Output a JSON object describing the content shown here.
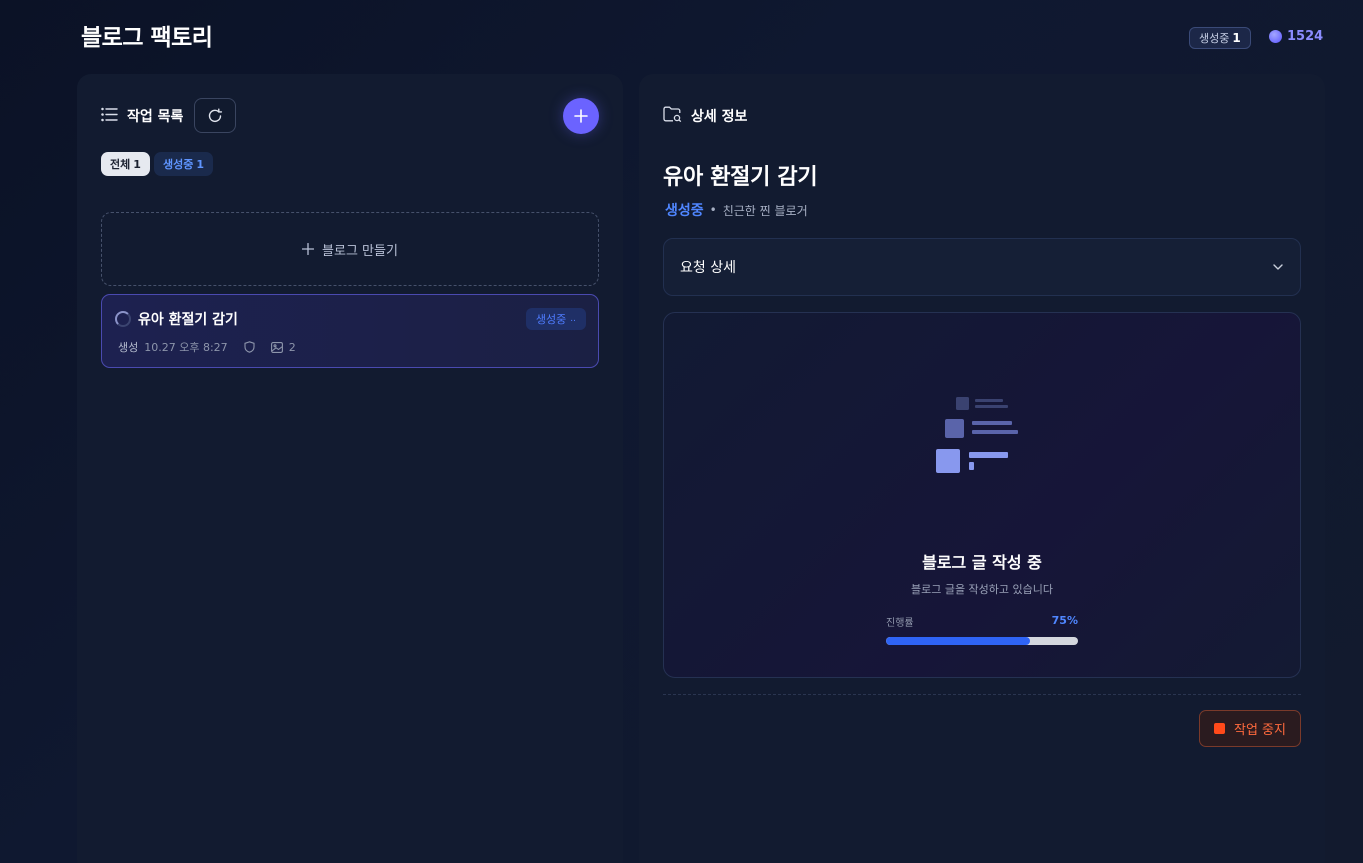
{
  "app": {
    "title": "블로그 팩토리"
  },
  "header": {
    "generating_badge": {
      "label": "생성중",
      "count": "1"
    },
    "credits": "1524"
  },
  "left_panel": {
    "title": "작업 목록",
    "filters": [
      {
        "label": "전체",
        "count": "1"
      },
      {
        "label": "생성중",
        "count": "1"
      }
    ],
    "create_label": "블로그 만들기",
    "jobs": [
      {
        "title": "유아 환절기 감기",
        "status": "생성중",
        "created_label": "생성",
        "created_at": "10.27 오후 8:27",
        "image_count": "2"
      }
    ]
  },
  "right_panel": {
    "title": "상세 정보",
    "job_title": "유아 환절기 감기",
    "status": "생성중",
    "persona": "친근한 찐 블로거",
    "request_detail_label": "요청 상세",
    "progress": {
      "title": "블로그 글 작성 중",
      "subtitle": "블로그 글을 작성하고 있습니다",
      "label": "진행률",
      "percent_text": "75%",
      "value": 0.75
    },
    "stop_label": "작업 중지"
  },
  "colors": {
    "accent": "#6b63ff",
    "status_blue": "#4f86ff",
    "danger": "#ff4a1a"
  }
}
